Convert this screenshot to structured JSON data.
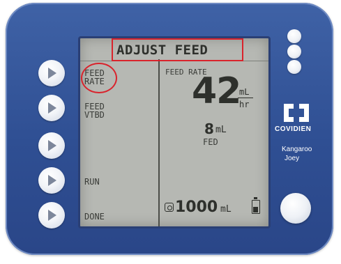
{
  "screen": {
    "title": "ADJUST FEED",
    "menu": [
      {
        "key": "feed_rate",
        "label": "FEED\nRATE"
      },
      {
        "key": "feed_vtbd",
        "label": "FEED\nVTBD"
      },
      {
        "key": "run",
        "label": "RUN"
      },
      {
        "key": "done",
        "label": "DONE"
      }
    ],
    "feed_rate": {
      "caption": "FEED RATE",
      "value": "42",
      "unit_top": "mL",
      "unit_bottom": "hr"
    },
    "fed": {
      "value": "8",
      "unit": "mL",
      "label": "FED"
    },
    "vtbd": {
      "value": "1000",
      "unit": "mL"
    }
  },
  "branding": {
    "company": "COVIDIEN",
    "product_line1": "Kangaroo",
    "product_line2": "Joey"
  },
  "colors": {
    "housing": "#3f62a6",
    "lcd": "#b6b8b3",
    "highlight": "#d9232c"
  }
}
